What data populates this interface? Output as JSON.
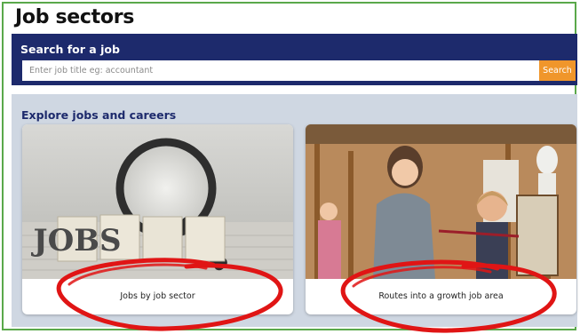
{
  "page": {
    "title": "Job sectors"
  },
  "search": {
    "heading": "Search for a job",
    "placeholder": "Enter job title eg: accountant",
    "button_label": "Search",
    "accent_color": "#f0962b",
    "panel_color": "#1d2a6c"
  },
  "explore": {
    "heading": "Explore jobs and careers",
    "cards": [
      {
        "label": "Jobs by job sector",
        "image": "magnifying-glass-over-jobs-blocks",
        "image_text": "JOBS"
      },
      {
        "label": "Routes into a growth job area",
        "image": "art-teacher-and-child-painting"
      }
    ]
  },
  "annotations": {
    "highlight_color": "#e01515"
  }
}
